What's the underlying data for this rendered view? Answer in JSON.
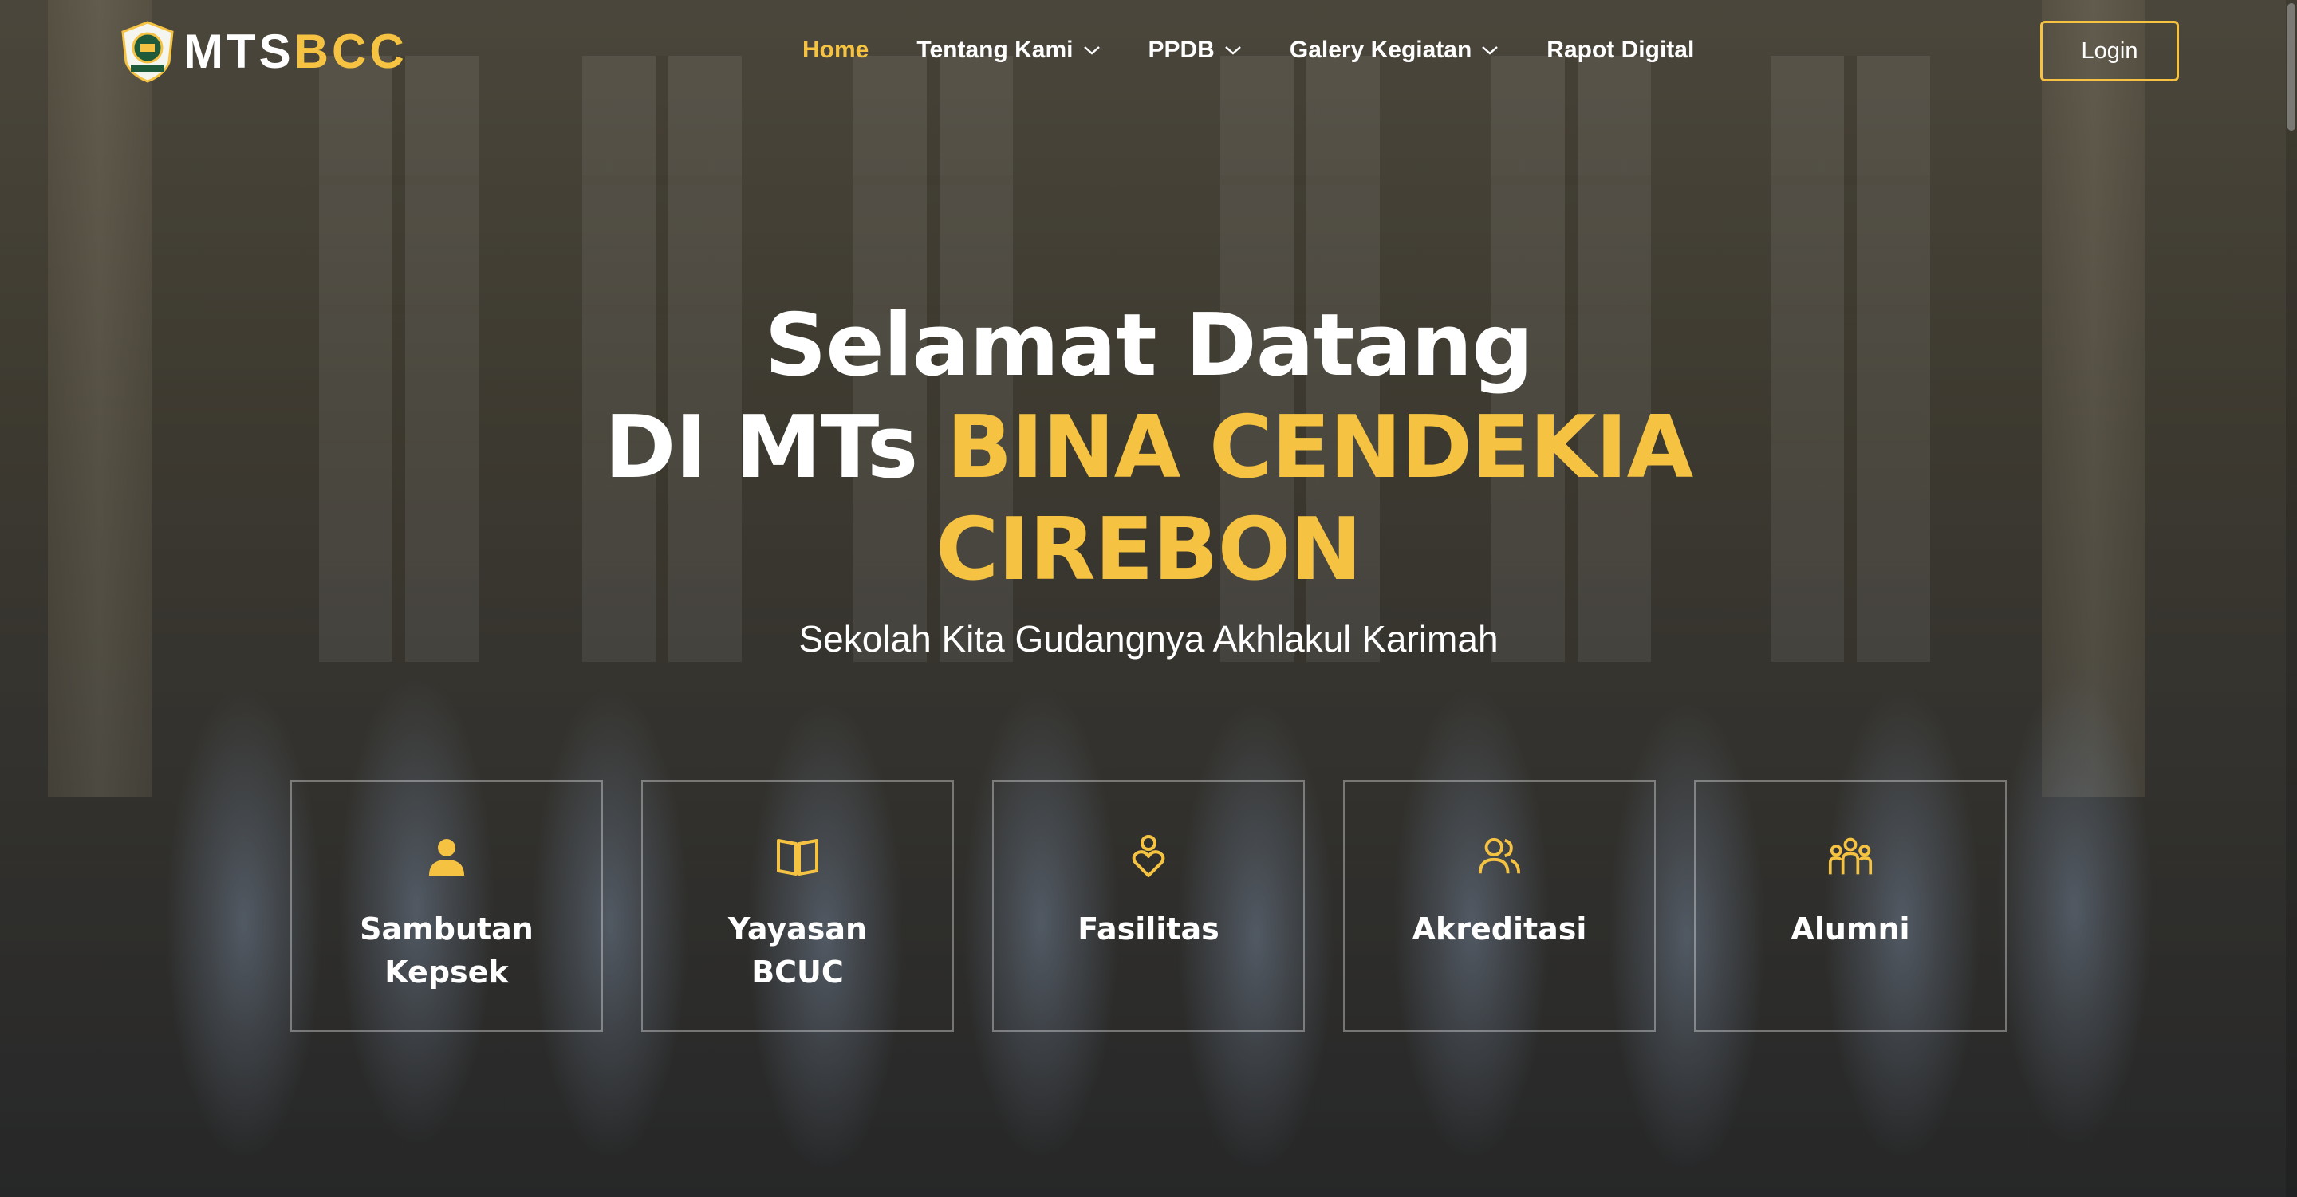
{
  "brand": {
    "part1": "MTS",
    "part2": "BCC",
    "badge_text": "MTs BINA CENDEKIA",
    "accent_color": "#f5c242"
  },
  "nav": {
    "items": [
      {
        "label": "Home",
        "active": true,
        "dropdown": false
      },
      {
        "label": "Tentang Kami",
        "active": false,
        "dropdown": true
      },
      {
        "label": "PPDB",
        "active": false,
        "dropdown": true
      },
      {
        "label": "Galery Kegiatan",
        "active": false,
        "dropdown": true
      },
      {
        "label": "Rapot Digital",
        "active": false,
        "dropdown": false
      }
    ],
    "login_label": "Login"
  },
  "hero": {
    "line1": "Selamat Datang",
    "line2_white": "DI MTs ",
    "line2_gold": "BINA CENDEKIA",
    "line3_gold": "CIREBON",
    "subtitle": "Sekolah Kita Gudangnya Akhlakul Karimah"
  },
  "features": [
    {
      "label": "Sambutan Kepsek",
      "icon": "person-icon"
    },
    {
      "label": "Yayasan BCUC",
      "icon": "open-book-icon"
    },
    {
      "label": "Fasilitas",
      "icon": "heart-person-icon"
    },
    {
      "label": "Akreditasi",
      "icon": "people-icon"
    },
    {
      "label": "Alumni",
      "icon": "group-icon"
    }
  ]
}
